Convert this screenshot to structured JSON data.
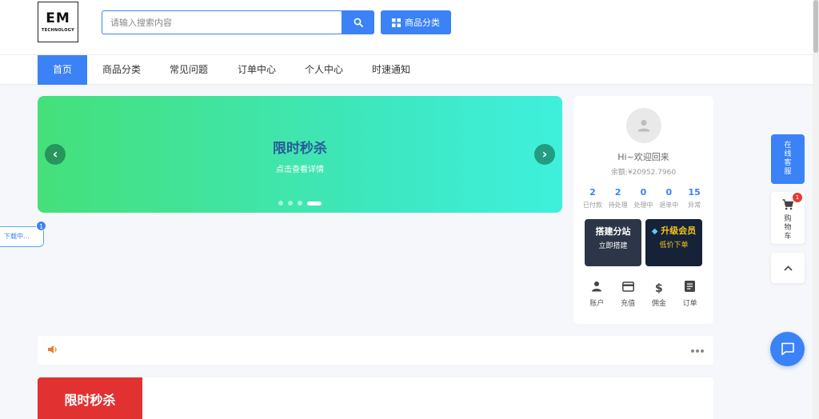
{
  "logo": {
    "main": "EM",
    "sub": "TECHNOLOGY"
  },
  "search": {
    "placeholder": "请输入搜索内容",
    "value": ""
  },
  "header": {
    "category_button": "商品分类"
  },
  "nav": {
    "items": [
      {
        "label": "首页",
        "active": true
      },
      {
        "label": "商品分类"
      },
      {
        "label": "常见问题"
      },
      {
        "label": "订单中心"
      },
      {
        "label": "个人中心"
      },
      {
        "label": "时速通知"
      }
    ]
  },
  "banner": {
    "title": "限时秒杀",
    "subtitle": "点击查看详情",
    "prev": "‹",
    "next": "›",
    "slide_count": 4,
    "active_slide": 4
  },
  "user": {
    "greeting": "Hi~欢迎回来",
    "balance": "余额:¥20952.7960",
    "stats": [
      {
        "value": "2",
        "label": "已付款"
      },
      {
        "value": "2",
        "label": "待处理"
      },
      {
        "value": "0",
        "label": "处理中"
      },
      {
        "value": "0",
        "label": "退单中"
      },
      {
        "value": "15",
        "label": "异常"
      }
    ],
    "promo_a": {
      "title": "搭建分站",
      "subtitle": "立即搭建"
    },
    "promo_b": {
      "title": "升级会员",
      "subtitle": "低价下单"
    },
    "quick_links": [
      {
        "label": "账户",
        "icon": "person-icon"
      },
      {
        "label": "充值",
        "icon": "card-icon"
      },
      {
        "label": "佣金",
        "icon": "dollar-icon"
      },
      {
        "label": "订单",
        "icon": "document-icon"
      }
    ]
  },
  "download": {
    "label": "下载中...",
    "count": "1"
  },
  "float": {
    "customer_service": "在线客服",
    "cart_label": "购物车",
    "cart_count": "1"
  },
  "sale": {
    "title": "限时秒杀"
  },
  "colors": {
    "accent": "#3b82f6",
    "sale_red": "#e23131",
    "gold": "#f5c518"
  }
}
